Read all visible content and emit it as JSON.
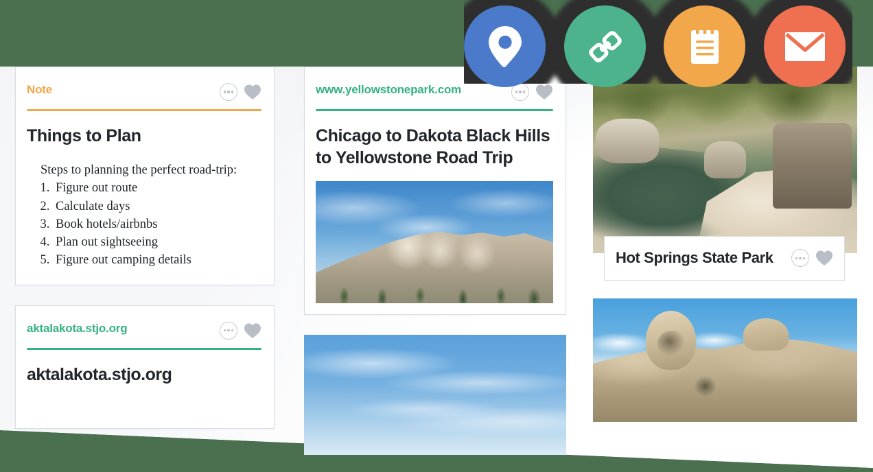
{
  "theme": {
    "background_green": "#4a7050",
    "surface_white": "#ffffff",
    "accent_orange": "#f2a74b",
    "accent_green": "#35b283",
    "text_dark": "#23272c",
    "icon_gray": "#b9bec6"
  },
  "toolbar": {
    "actions": [
      {
        "name": "location-icon",
        "label": "Location",
        "color": "#4a7ac9"
      },
      {
        "name": "link-icon",
        "label": "Link",
        "color": "#4db38d"
      },
      {
        "name": "note-icon",
        "label": "Note",
        "color": "#f2a74b"
      },
      {
        "name": "email-icon",
        "label": "Email",
        "color": "#ef6f51"
      }
    ]
  },
  "card_actions": {
    "more_label": "More options",
    "favorite_label": "Favorite"
  },
  "columns": [
    {
      "cards": [
        {
          "type": "note",
          "source": "Note",
          "source_color": "orange",
          "title": "Things to Plan",
          "intro": "Steps to planning the perfect road-trip:",
          "steps": [
            "Figure out route",
            "Calculate days",
            "Book hotels/airbnbs",
            "Plan out sightseeing",
            "Figure out camping details"
          ]
        },
        {
          "type": "link",
          "source": "aktalakota.stjo.org",
          "source_color": "green",
          "title": "aktalakota.stjo.org"
        }
      ]
    },
    {
      "cards": [
        {
          "type": "article",
          "source": "www.yellowstonepark.com",
          "source_color": "green",
          "title": "Chicago to Dakota Black Hills to Yellowstone Road Trip",
          "image_name": "mount-rushmore-photo"
        },
        {
          "type": "photo",
          "image_name": "blue-sky-photo"
        }
      ]
    },
    {
      "cards": [
        {
          "type": "photo_caption",
          "image_name": "hot-springs-photo",
          "title": "Hot Springs State Park"
        },
        {
          "type": "photo",
          "image_name": "crazy-horse-memorial-photo"
        }
      ]
    }
  ]
}
